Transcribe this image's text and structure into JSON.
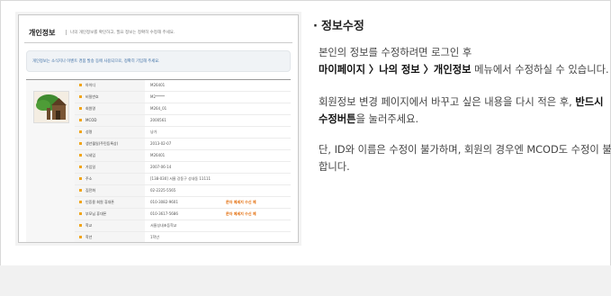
{
  "screenshot": {
    "title": "개인정보",
    "desc": "나의 개인정보를 확인하고, 필요 정보는 정확히 수정해 주세요.",
    "notice": "개인정보는 소식지나 이벤트 경품 발송 등에 사용되므로, 정확히 기입해 주세요.",
    "rows": [
      {
        "label": "아이디",
        "value": "M26401",
        "sms": ""
      },
      {
        "label": "비밀번호",
        "value": "M2*****",
        "sms": ""
      },
      {
        "label": "회원명",
        "value": "M264_01",
        "sms": ""
      },
      {
        "label": "MCOD",
        "value": "2000561",
        "sms": ""
      },
      {
        "label": "성명",
        "value": "냥가",
        "sms": ""
      },
      {
        "label": "생년월일(주민등록상)",
        "value": "2013-02-07",
        "sms": ""
      },
      {
        "label": "닉네임",
        "value": "M26401",
        "sms": ""
      },
      {
        "label": "가입일",
        "value": "2007-06-14",
        "sms": ""
      },
      {
        "label": "주소",
        "value": "[138-030] 서울 강동구 성내동 11111",
        "sms": ""
      },
      {
        "label": "집전화",
        "value": "02-2225-5565",
        "sms": ""
      },
      {
        "label": "인증용 회원 휴대폰",
        "value": "010-3082-9601",
        "sms": "문자 메세지 수신 예"
      },
      {
        "label": "부모님 휴대폰",
        "value": "010-3617-5686",
        "sms": "문자 메세지 수신 예"
      },
      {
        "label": "학교",
        "value": "서울성내초등학교",
        "sms": ""
      },
      {
        "label": "학년",
        "value": "1학년",
        "sms": ""
      }
    ]
  },
  "info": {
    "heading": "정보수정",
    "p1_line1": "본인의 정보를 수정하려면 로그인 후",
    "p1_bold": "마이페이지 〉나의 정보 〉개인정보",
    "p1_rest": " 메뉴에서 수정하실 수 있습니다.",
    "p2_line1_pre": "회원정보 변경 페이지에서 바꾸고 싶은 내용을 다시 적은 후, ",
    "p2_line1_bold": "반드시",
    "p2_line2_bold": "수정버튼",
    "p2_line2_rest": "을 눌러주세요.",
    "p3_line1": "단, ID와 이름은 수정이 불가하며, 회원의 경우엔 MCOD도 수정이 불가능",
    "p3_line2": "합니다."
  }
}
